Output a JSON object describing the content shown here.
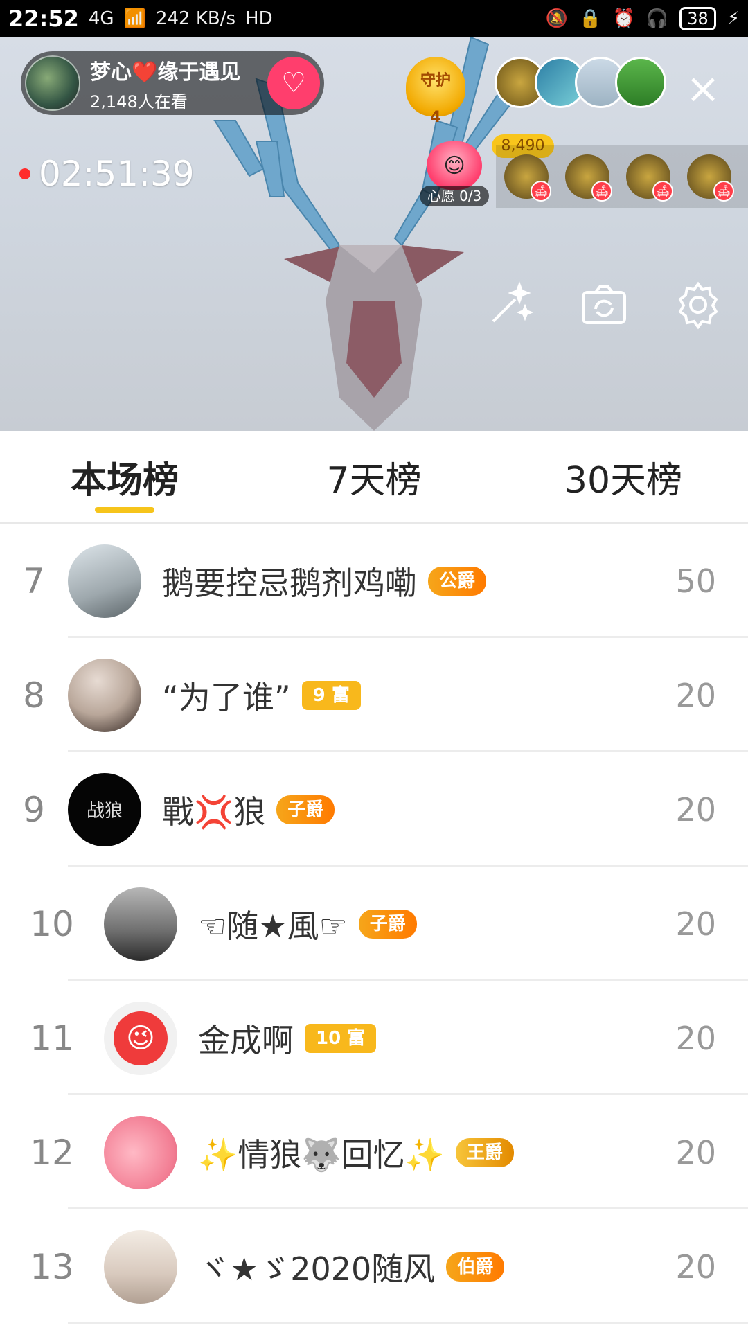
{
  "status_bar": {
    "time": "22:52",
    "network": "4G",
    "speed": "242 KB/s",
    "hd": "HD",
    "battery": "38"
  },
  "host": {
    "name": "梦心❤️缘于遇见",
    "viewers": "2,148人在看",
    "follow_icon": "heart-plus-icon"
  },
  "guard": {
    "label": "守护",
    "count": "4"
  },
  "fans": {
    "score": "8,490"
  },
  "timer": "02:51:39",
  "wish": {
    "label": "心愿 0/3"
  },
  "tabs": [
    {
      "label": "本场榜",
      "active": true
    },
    {
      "label": "7天榜",
      "active": false
    },
    {
      "label": "30天榜",
      "active": false
    }
  ],
  "rows": [
    {
      "rank": "7",
      "name": "鹅要控忌鹅剂鸡嘞",
      "badge": "公爵",
      "score": "50"
    },
    {
      "rank": "8",
      "name": "“为了谁”",
      "badge": "9 富",
      "score": "20"
    },
    {
      "rank": "9",
      "name": "戰💢狼",
      "badge": "子爵",
      "score": "20",
      "avatar_text": "战狼"
    },
    {
      "rank": "10",
      "name": "☜随★風☞",
      "badge": "子爵",
      "score": "20"
    },
    {
      "rank": "11",
      "name": "金成啊",
      "badge": "10 富",
      "score": "20",
      "avatar_text": "😉"
    },
    {
      "rank": "12",
      "name": "✨情狼🐺回忆✨",
      "badge": "王爵",
      "score": "20"
    },
    {
      "rank": "13",
      "name": "ヾ★ゞ2020随风",
      "badge": "伯爵",
      "score": "20"
    }
  ]
}
